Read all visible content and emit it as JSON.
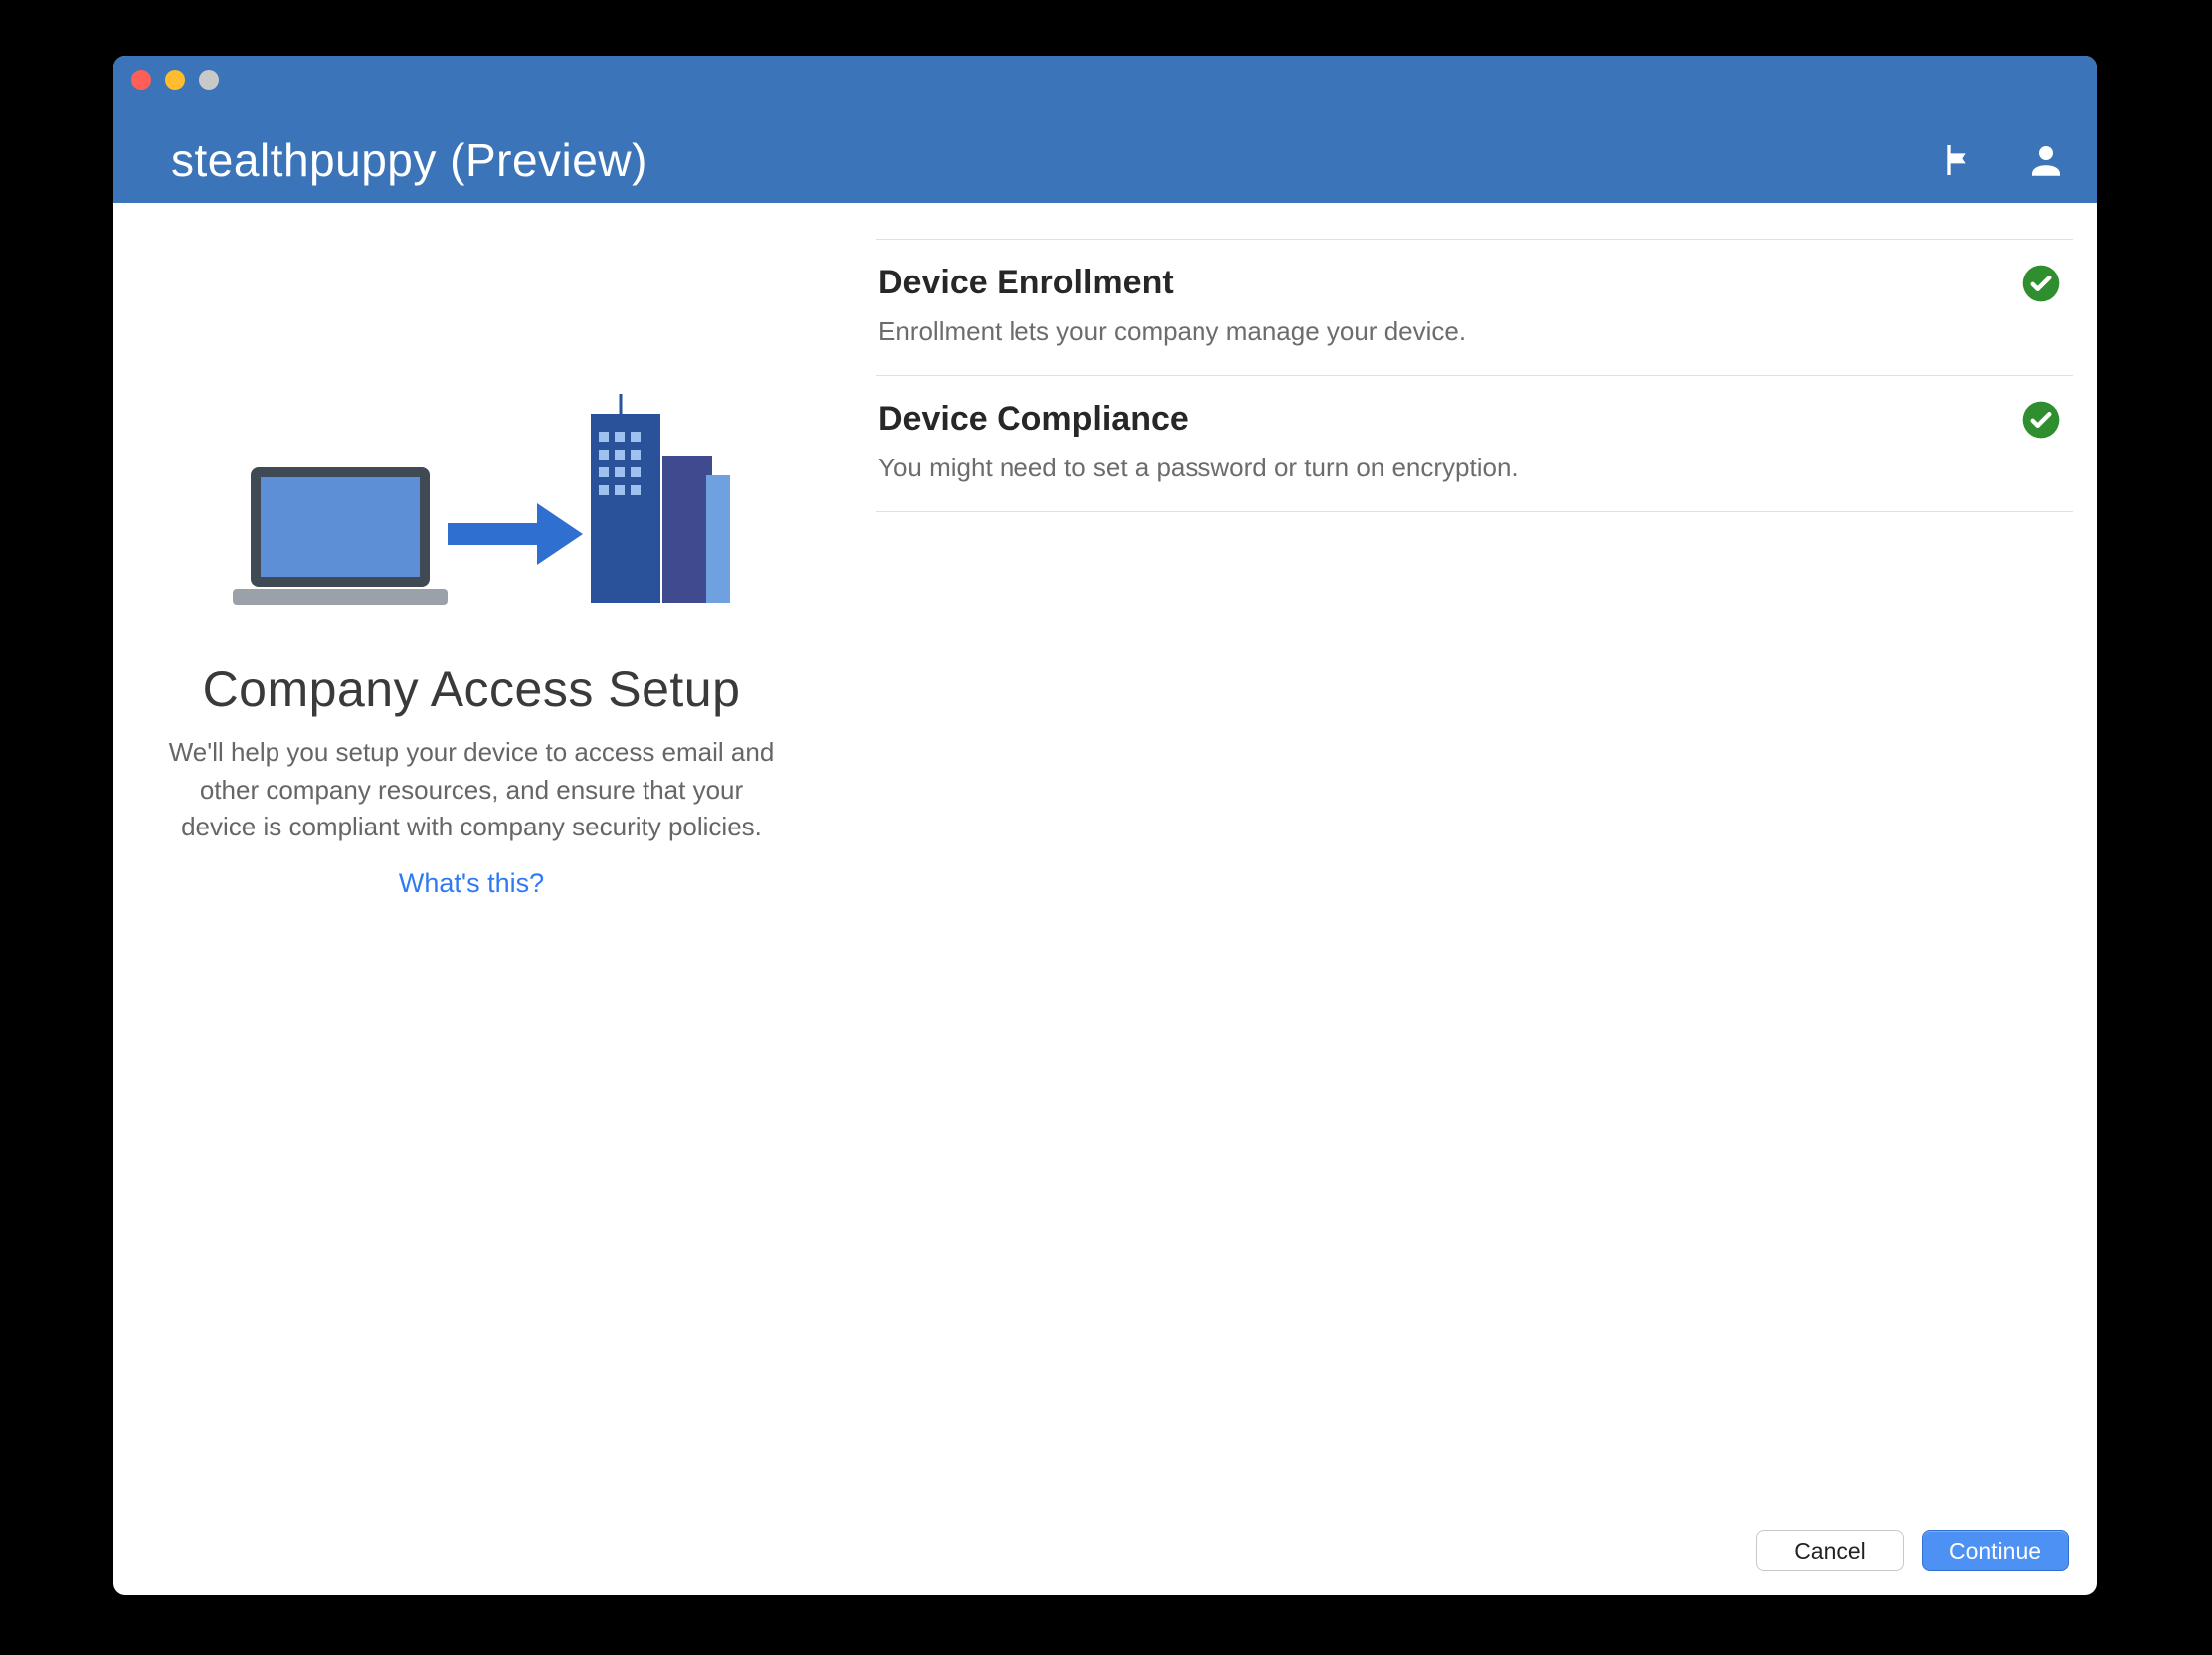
{
  "header": {
    "title": "stealthpuppy (Preview)"
  },
  "left": {
    "heading": "Company Access Setup",
    "description": "We'll help you setup your device to access email and other company resources, and ensure that your device is compliant with company security policies.",
    "whats_this": "What's this?"
  },
  "items": [
    {
      "title": "Device Enrollment",
      "subtitle": "Enrollment lets your company manage your device.",
      "status": "ok"
    },
    {
      "title": "Device Compliance",
      "subtitle": "You might need to set a password or turn on encryption.",
      "status": "ok"
    }
  ],
  "buttons": {
    "cancel": "Cancel",
    "continue": "Continue"
  },
  "colors": {
    "header": "#3c74b9",
    "primary_button": "#4e91f5",
    "link": "#2f7af4",
    "status_ok": "#2f8f2f"
  }
}
